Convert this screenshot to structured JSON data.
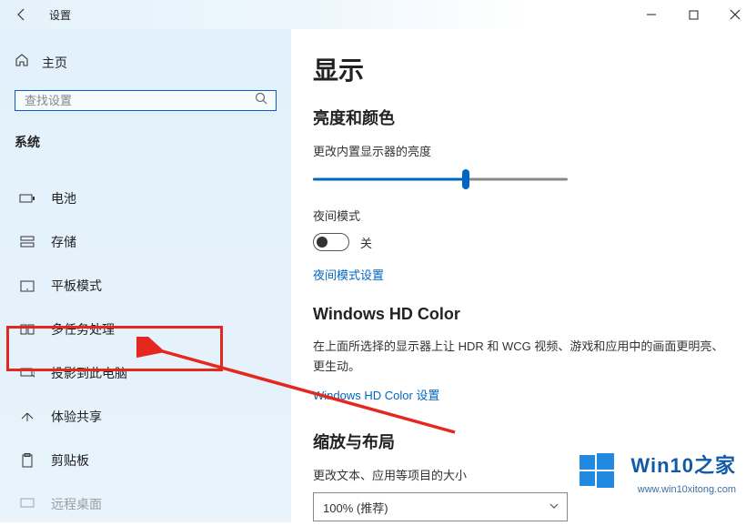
{
  "window": {
    "title": "设置"
  },
  "sidebar": {
    "home_label": "主页",
    "search_placeholder": "查找设置",
    "group_label": "系统",
    "items": [
      {
        "label": "电池"
      },
      {
        "label": "存储"
      },
      {
        "label": "平板模式"
      },
      {
        "label": "多任务处理"
      },
      {
        "label": "投影到此电脑"
      },
      {
        "label": "体验共享"
      },
      {
        "label": "剪贴板"
      },
      {
        "label": "远程桌面"
      }
    ]
  },
  "content": {
    "page_title": "显示",
    "brightness": {
      "section_title": "亮度和颜色",
      "slider_label": "更改内置显示器的亮度",
      "slider_percent": 60
    },
    "night_light": {
      "label": "夜间模式",
      "state_text": "关",
      "settings_link": "夜间模式设置"
    },
    "hdcolor": {
      "section_title": "Windows HD Color",
      "description": "在上面所选择的显示器上让 HDR 和 WCG 视频、游戏和应用中的画面更明亮、更生动。",
      "settings_link": "Windows HD Color 设置"
    },
    "scale": {
      "section_title": "缩放与布局",
      "combo_label": "更改文本、应用等项目的大小",
      "combo_value": "100% (推荐)"
    }
  },
  "watermark": {
    "brand": "Win10之家",
    "url": "www.win10xitong.com"
  }
}
